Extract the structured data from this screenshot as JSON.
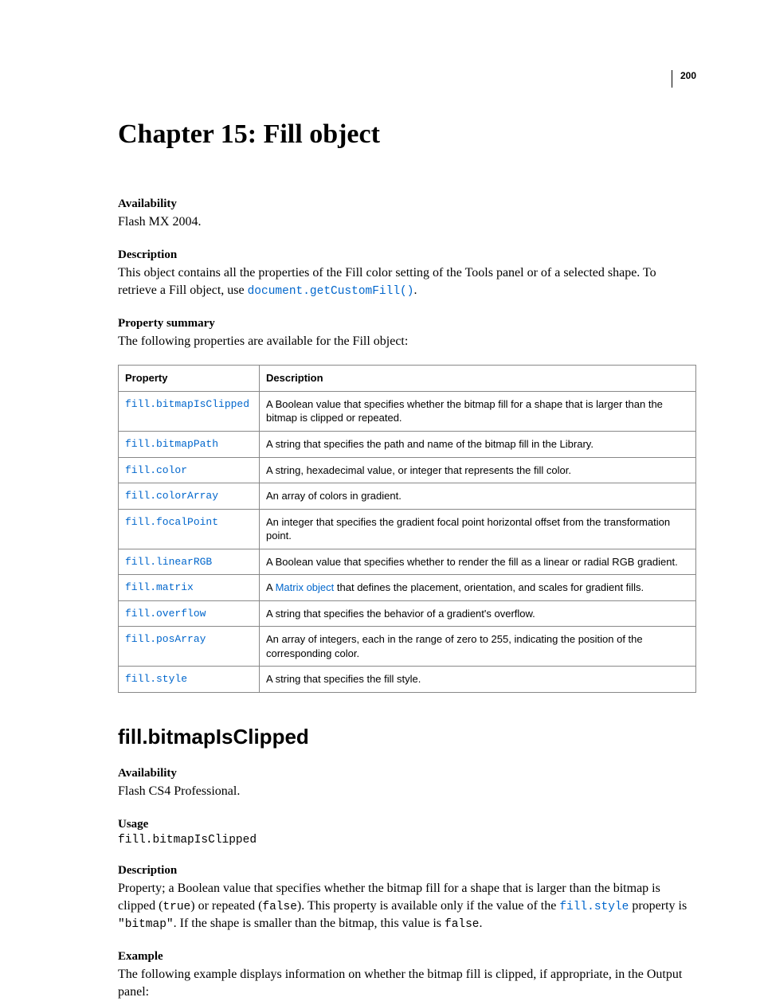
{
  "page_number": "200",
  "chapter_title": "Chapter 15: Fill object",
  "sec1": {
    "availability_h": "Availability",
    "availability_t": "Flash MX 2004.",
    "description_h": "Description",
    "description_p1_a": "This object contains all the properties of the Fill color setting of the Tools panel or of a selected shape. To retrieve a Fill object, use ",
    "description_link": "document.getCustomFill()",
    "description_p1_b": ".",
    "propsum_h": "Property summary",
    "propsum_t": "The following properties are available for the Fill object:"
  },
  "table": {
    "head_prop": "Property",
    "head_desc": "Description",
    "rows": [
      {
        "prop": "fill.bitmapIsClipped",
        "desc_a": "A Boolean value that specifies whether the bitmap fill for a shape that is larger than the bitmap is clipped or repeated."
      },
      {
        "prop": "fill.bitmapPath",
        "desc_a": "A string that specifies the path and name of the bitmap fill in the Library."
      },
      {
        "prop": "fill.color",
        "desc_a": "A string, hexadecimal value, or integer that represents the fill color."
      },
      {
        "prop": "fill.colorArray",
        "desc_a": "An array of colors in gradient."
      },
      {
        "prop": "fill.focalPoint",
        "desc_a": "An integer that specifies the gradient focal point horizontal offset from the transformation point."
      },
      {
        "prop": "fill.linearRGB",
        "desc_a": "A Boolean value that specifies whether to render the fill as a linear or radial RGB gradient."
      },
      {
        "prop": "fill.matrix",
        "desc_a": "A ",
        "desc_link": "Matrix object",
        "desc_b": " that defines the placement, orientation, and scales for gradient fills."
      },
      {
        "prop": "fill.overflow",
        "desc_a": "A string that specifies the behavior of a gradient's overflow."
      },
      {
        "prop": "fill.posArray",
        "desc_a": "An array of integers, each in the range of zero to 255, indicating the position of the corresponding color."
      },
      {
        "prop": "fill.style",
        "desc_a": "A string that specifies the fill style."
      }
    ]
  },
  "sec2": {
    "title": "fill.bitmapIsClipped",
    "availability_h": "Availability",
    "availability_t": "Flash CS4 Professional.",
    "usage_h": "Usage",
    "usage_code": "fill.bitmapIsClipped",
    "description_h": "Description",
    "desc_a": "Property; a Boolean value that specifies whether the bitmap fill for a shape that is larger than the bitmap is clipped (",
    "desc_code1": "true",
    "desc_b": ") or repeated (",
    "desc_code2": "false",
    "desc_c": "). This property is available only if the value of the ",
    "desc_link": "fill.style",
    "desc_d": " property is ",
    "desc_code3": "\"bitmap\"",
    "desc_e": ". If the shape is smaller than the bitmap, this value is ",
    "desc_code4": "false",
    "desc_f": ".",
    "example_h": "Example",
    "example_t": "The following example displays information on whether the bitmap fill is clipped, if appropriate, in the Output panel:"
  }
}
